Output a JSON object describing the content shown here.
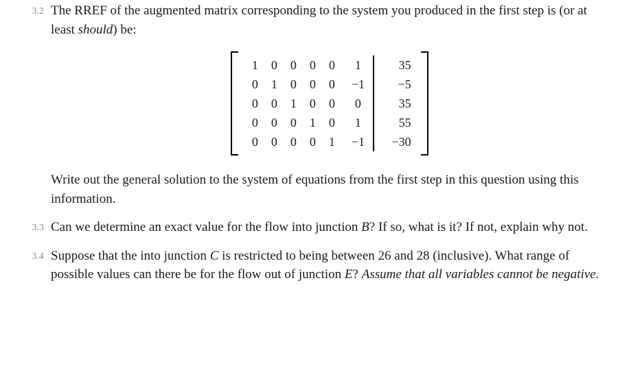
{
  "q32": {
    "num": "3.2",
    "para1_a": "The RREF of the augmented matrix corresponding to the system you produced in the first step is (or at least ",
    "para1_ital": "should",
    "para1_b": ") be:",
    "matrix": {
      "A": [
        [
          "1",
          "0",
          "0",
          "0",
          "0"
        ],
        [
          "0",
          "1",
          "0",
          "0",
          "0"
        ],
        [
          "0",
          "0",
          "1",
          "0",
          "0"
        ],
        [
          "0",
          "0",
          "0",
          "1",
          "0"
        ],
        [
          "0",
          "0",
          "0",
          "0",
          "1"
        ]
      ],
      "B": [
        "1",
        "−1",
        "0",
        "1",
        "−1"
      ],
      "C": [
        "35",
        "−5",
        "35",
        "55",
        "−30"
      ]
    },
    "para2": "Write out the general solution to the system of equations from the first step in this question using this information."
  },
  "q33": {
    "num": "3.3",
    "text_a": "Can we determine an exact value for the flow into junction ",
    "jB": "B",
    "text_b": "? If so, what is it? If not, explain why not."
  },
  "q34": {
    "num": "3.4",
    "text_a": "Suppose that the into junction ",
    "jC": "C",
    "text_b": " is restricted to being between 26 and 28 (inclusive). What range of possible values can there be for the flow out of junction ",
    "jE": "E",
    "text_c": "? ",
    "ital": "Assume that all variables cannot be negative."
  }
}
